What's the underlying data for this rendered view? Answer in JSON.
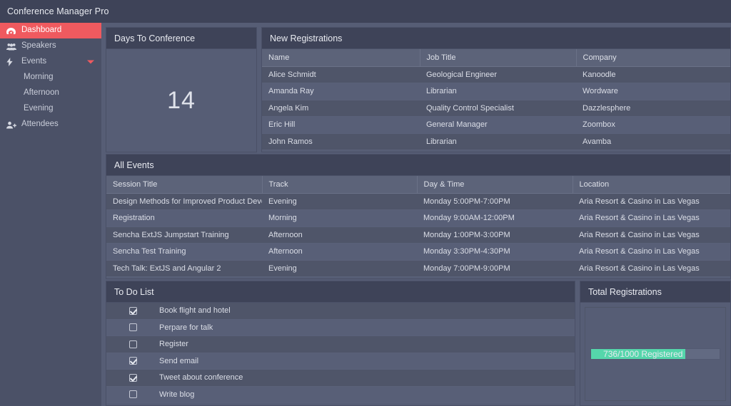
{
  "app": {
    "title": "Conference Manager Pro",
    "accent_color": "#ef5a5f",
    "topbar_color": "#3e4358",
    "sidebar_color": "#4b5167",
    "content_color": "#565d75",
    "panel_header_color": "#3e4358",
    "progress_color": "#55d6ab"
  },
  "sidebar": {
    "items": [
      {
        "label": "Dashboard",
        "icon": "dashboard-gauge-icon",
        "active": true,
        "child": false,
        "caret": false
      },
      {
        "label": "Speakers",
        "icon": "users-group-icon",
        "active": false,
        "child": false,
        "caret": false
      },
      {
        "label": "Events",
        "icon": "lightning-bolt-icon",
        "active": false,
        "child": false,
        "caret": true
      },
      {
        "label": "Morning",
        "icon": "",
        "active": false,
        "child": true,
        "caret": false
      },
      {
        "label": "Afternoon",
        "icon": "",
        "active": false,
        "child": true,
        "caret": false
      },
      {
        "label": "Evening",
        "icon": "",
        "active": false,
        "child": true,
        "caret": false
      },
      {
        "label": "Attendees",
        "icon": "user-plus-icon",
        "active": false,
        "child": false,
        "caret": false
      }
    ]
  },
  "panels": {
    "days_to_conference": {
      "title": "Days To Conference",
      "value": "14"
    },
    "new_registrations": {
      "title": "New Registrations",
      "columns": [
        "Name",
        "Job Title",
        "Company"
      ],
      "rows": [
        [
          "Alice Schmidt",
          "Geological Engineer",
          "Kanoodle"
        ],
        [
          "Amanda Ray",
          "Librarian",
          "Wordware"
        ],
        [
          "Angela Kim",
          "Quality Control Specialist",
          "Dazzlesphere"
        ],
        [
          "Eric Hill",
          "General Manager",
          "Zoombox"
        ],
        [
          "John Ramos",
          "Librarian",
          "Avamba"
        ]
      ]
    },
    "all_events": {
      "title": "All Events",
      "columns": [
        "Session Title",
        "Track",
        "Day & Time",
        "Location"
      ],
      "rows": [
        [
          "Design Methods for Improved Product Developm.",
          "Evening",
          "Monday 5:00PM-7:00PM",
          "Aria Resort & Casino in Las Vegas"
        ],
        [
          "Registration",
          "Morning",
          "Monday 9:00AM-12:00PM",
          "Aria Resort & Casino in Las Vegas"
        ],
        [
          "Sencha ExtJS Jumpstart Training",
          "Afternoon",
          "Monday 1:00PM-3:00PM",
          "Aria Resort & Casino in Las Vegas"
        ],
        [
          "Sencha Test Training",
          "Afternoon",
          "Monday 3:30PM-4:30PM",
          "Aria Resort & Casino in Las Vegas"
        ],
        [
          "Tech Talk: ExtJS and Angular 2",
          "Evening",
          "Monday 7:00PM-9:00PM",
          "Aria Resort & Casino in Las Vegas"
        ]
      ]
    },
    "to_do_list": {
      "title": "To Do List",
      "items": [
        {
          "label": "Book flight and hotel",
          "checked": true
        },
        {
          "label": "Perpare for talk",
          "checked": false
        },
        {
          "label": "Register",
          "checked": false
        },
        {
          "label": "Send email",
          "checked": true
        },
        {
          "label": "Tweet about conference",
          "checked": true
        },
        {
          "label": "Write blog",
          "checked": false
        }
      ]
    },
    "total_registrations": {
      "title": "Total Registrations",
      "progress_text": "736/1000 Registered",
      "registered": 736,
      "capacity": 1000,
      "percent": 73.6
    }
  }
}
